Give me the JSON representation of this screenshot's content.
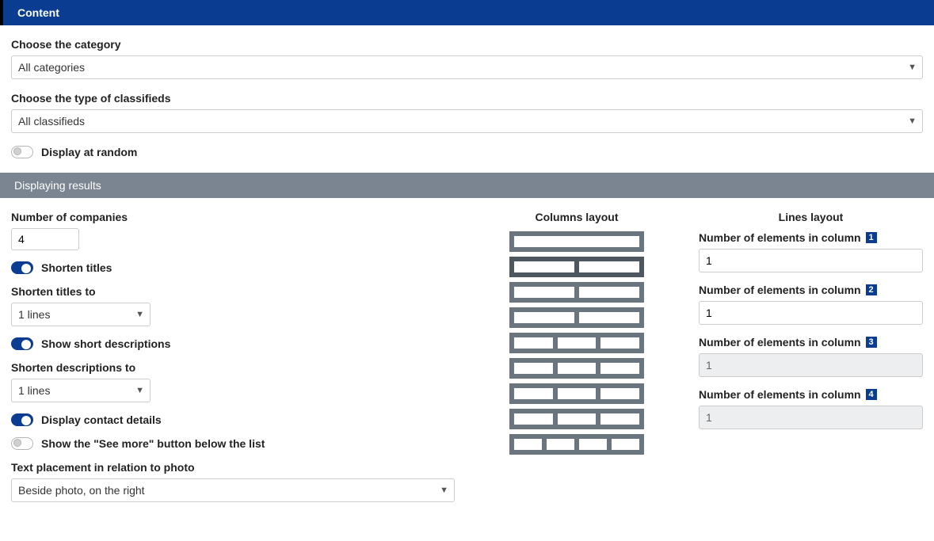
{
  "sections": {
    "content_header": "Content",
    "results_header": "Displaying results"
  },
  "content": {
    "category_label": "Choose the category",
    "category_value": "All categories",
    "classifieds_label": "Choose the type of classifieds",
    "classifieds_value": "All classifieds",
    "display_random_label": "Display at random",
    "display_random_on": false
  },
  "results": {
    "left": {
      "num_companies_label": "Number of companies",
      "num_companies_value": "4",
      "shorten_titles_label": "Shorten titles",
      "shorten_titles_on": true,
      "shorten_titles_to_label": "Shorten titles to",
      "shorten_titles_to_value": "1 lines",
      "show_short_desc_label": "Show short descriptions",
      "show_short_desc_on": true,
      "shorten_desc_to_label": "Shorten descriptions to",
      "shorten_desc_to_value": "1 lines",
      "display_contact_label": "Display contact details",
      "display_contact_on": true,
      "see_more_label": "Show the \"See more\" button below the list",
      "see_more_on": false,
      "text_placement_label": "Text placement in relation to photo",
      "text_placement_value": "Beside photo, on the right"
    },
    "center": {
      "title": "Columns layout",
      "options": [
        {
          "cols": 1,
          "selected": false
        },
        {
          "cols": 2,
          "selected": true
        },
        {
          "cols": 2,
          "selected": false
        },
        {
          "cols": 2,
          "selected": false
        },
        {
          "cols": 3,
          "selected": false
        },
        {
          "cols": 3,
          "selected": false
        },
        {
          "cols": 3,
          "selected": false
        },
        {
          "cols": 3,
          "selected": false
        },
        {
          "cols": 4,
          "selected": false
        }
      ]
    },
    "right": {
      "title": "Lines layout",
      "fields": [
        {
          "label": "Number of elements in column",
          "badge": "1",
          "value": "1",
          "disabled": false
        },
        {
          "label": "Number of elements in column",
          "badge": "2",
          "value": "1",
          "disabled": false
        },
        {
          "label": "Number of elements in column",
          "badge": "3",
          "value": "1",
          "disabled": true
        },
        {
          "label": "Number of elements in column",
          "badge": "4",
          "value": "1",
          "disabled": true
        }
      ]
    }
  }
}
